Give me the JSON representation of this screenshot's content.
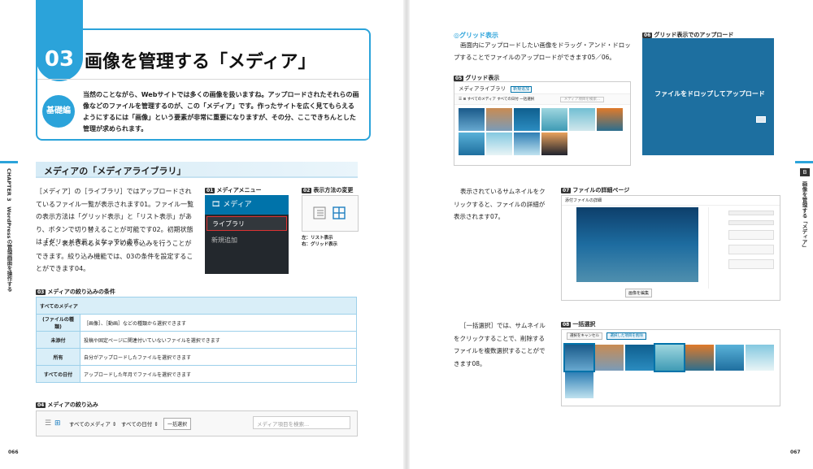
{
  "chapter": {
    "number": "03",
    "title": "画像を管理する「メディア」",
    "level_badge": "基礎編",
    "intro": "当然のことながら、Webサイトでは多くの画像を扱いますね。アップロードされたそれらの画像などのファイルを管理するのが、この「メディア」です。作ったサイトを広く見てもらえるようにするには「画像」という要素が非常に重要になりますが、その分、ここできちんとした管理が求められます。"
  },
  "left_sidebar": {
    "label": "CHAPTER 3　WordPressの管理画面を操作する"
  },
  "right_sidebar": {
    "number": "B",
    "label": "画像を管理する「メディア」"
  },
  "section": {
    "title": "メディアの「メディアライブラリ」"
  },
  "body_left": {
    "p1": "［メディア］の［ライブラリ］ではアップロードされているファイル一覧が表示されます01。ファイル一覧の表示方法は「グリッド表示」と「リスト表示」があり、ボタンで切り替えることが可能です02。初期状態は「グリッド表示」となっています。",
    "p2": "また、表示されるメディアの絞り込みを行うことができます。絞り込み機能では、03の条件を設定することができます04。"
  },
  "fig01": {
    "num": "01",
    "label": "メディアメニュー",
    "menu_title": "メディア",
    "item_library": "ライブラリ",
    "item_add": "新規追加"
  },
  "fig02": {
    "num": "02",
    "label": "表示方法の変更",
    "caption1": "左：リスト表示",
    "caption2": "右：グリッド表示"
  },
  "fig03": {
    "num": "03",
    "label": "メディアの絞り込みの条件",
    "rows": [
      {
        "head": "すべてのメディア",
        "desc": ""
      },
      {
        "head": "(ファイルの種類)",
        "desc": "［画像］、［動画］などの種類から選択できます"
      },
      {
        "head": "未添付",
        "desc": "投稿や固定ページに関連付いていないファイルを選択できます"
      },
      {
        "head": "所有",
        "desc": "自分がアップロードしたファイルを選択できます"
      },
      {
        "head": "すべての日付",
        "desc": "アップロードした年月でファイルを選択できます"
      }
    ]
  },
  "fig04": {
    "num": "04",
    "label": "メディアの絞り込み",
    "filter_all_media": "すべてのメディア ⇕",
    "filter_all_dates": "すべての日付 ⇕",
    "bulk_button": "一括選択",
    "search_placeholder": "メディア項目を検索..."
  },
  "page_left": "066",
  "page_right": "067",
  "grid_section": {
    "title": "◎グリッド表示",
    "text": "画面内にアップロードしたい画像をドラッグ・アンド・ドロップすることでファイルのアップロードができます05／06。"
  },
  "fig05": {
    "num": "05",
    "label": "グリッド表示",
    "screen_title": "メディアライブラリ",
    "new_button": "新規追加",
    "filter1": "すべてのメディア",
    "filter2": "すべての日付",
    "bulk": "一括選択",
    "search": "メディア項目を検索..."
  },
  "fig06": {
    "num": "06",
    "label": "グリッド表示でのアップロード",
    "drop_text": "ファイルをドロップしてアップロード"
  },
  "detail_section": {
    "text": "表示されているサムネイルをクリックすると、ファイルの詳細が表示されます07。"
  },
  "fig07": {
    "num": "07",
    "label": "ファイルの詳細ページ",
    "screen_title": "添付ファイルの詳細",
    "edit_button": "画像を編集"
  },
  "bulk_section": {
    "text": "［一括選択］では、サムネイルをクリックすることで、削除するファイルを複数選択することができます08。"
  },
  "fig08": {
    "num": "08",
    "label": "一括選択",
    "cancel": "選択をキャンセル",
    "delete": "選択した項目を削除"
  },
  "colors": {
    "accent": "#2ba3da",
    "wp_admin_dark": "#23282d",
    "wp_blue": "#0073aa"
  }
}
